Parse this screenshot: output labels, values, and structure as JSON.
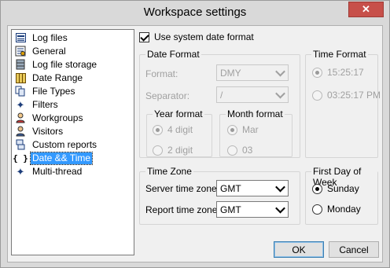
{
  "window": {
    "title": "Workspace settings",
    "close_glyph": "✕"
  },
  "nav": {
    "items": [
      {
        "label": "Log files",
        "icon": "log-files-icon"
      },
      {
        "label": "General",
        "icon": "general-icon"
      },
      {
        "label": "Log file storage",
        "icon": "storage-icon"
      },
      {
        "label": "Date Range",
        "icon": "calendar-icon"
      },
      {
        "label": "File Types",
        "icon": "file-types-icon"
      },
      {
        "label": "Filters",
        "icon": "filters-icon"
      },
      {
        "label": "Workgroups",
        "icon": "workgroups-icon"
      },
      {
        "label": "Visitors",
        "icon": "visitors-icon"
      },
      {
        "label": "Custom reports",
        "icon": "custom-reports-icon"
      },
      {
        "label": "Date && Time",
        "icon": "braces-icon",
        "selected": true
      },
      {
        "label": "Multi-thread",
        "icon": "multi-thread-icon"
      }
    ]
  },
  "use_system_date": {
    "label": "Use system date format",
    "checked": true
  },
  "date_format": {
    "title": "Date Format",
    "format_label": "Format:",
    "format_value": "DMY",
    "separator_label": "Separator:",
    "separator_value": "/",
    "year_format": {
      "title": "Year format",
      "options": [
        "4 digit",
        "2 digit"
      ],
      "selected": 0
    },
    "month_format": {
      "title": "Month format",
      "options": [
        "Mar",
        "03"
      ],
      "selected": 0
    }
  },
  "time_format": {
    "title": "Time Format",
    "options": [
      "15:25:17",
      "03:25:17 PM"
    ],
    "selected": 0
  },
  "time_zone": {
    "title": "Time Zone",
    "server_label": "Server time zone:",
    "server_value": "GMT",
    "report_label": "Report time zone:",
    "report_value": "GMT"
  },
  "first_day": {
    "title": "First Day of Week",
    "options": [
      "Sunday",
      "Monday"
    ],
    "selected": 0
  },
  "buttons": {
    "ok": "OK",
    "cancel": "Cancel"
  }
}
